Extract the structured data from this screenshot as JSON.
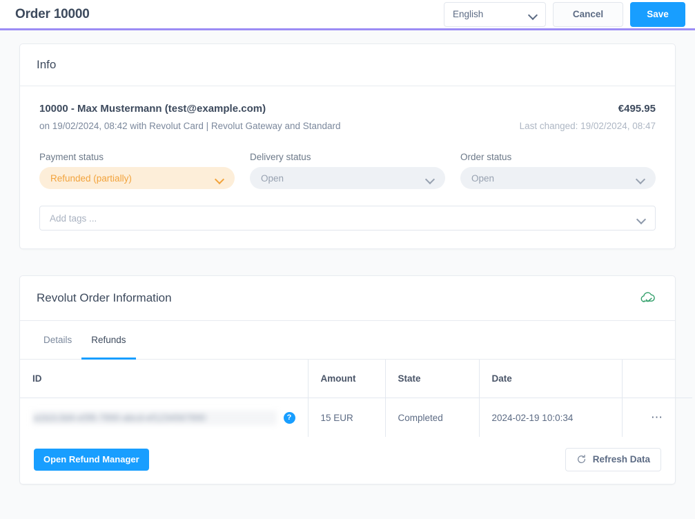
{
  "header": {
    "title": "Order 10000",
    "language": "English",
    "cancel_label": "Cancel",
    "save_label": "Save",
    "accent_line_color": "#9c8cf5",
    "primary_color": "#189eff"
  },
  "info": {
    "panel_title": "Info",
    "order_title": "10000 - Max Mustermann (test@example.com)",
    "order_subtitle": "on 19/02/2024, 08:42 with Revolut Card | Revolut Gateway and Standard",
    "amount": "€495.95",
    "last_changed": "Last changed: 19/02/2024, 08:47",
    "statuses": [
      {
        "label": "Payment status",
        "value": "Refunded (partially)",
        "style": "warning",
        "bg_color": "#fdeed9",
        "text_color": "#f2a33c"
      },
      {
        "label": "Delivery status",
        "value": "Open",
        "style": "neutral",
        "bg_color": "#eef1f5",
        "text_color": "#97a1b0"
      },
      {
        "label": "Order status",
        "value": "Open",
        "style": "neutral",
        "bg_color": "#eef1f5",
        "text_color": "#97a1b0"
      }
    ],
    "tags_placeholder": "Add tags ..."
  },
  "revolut": {
    "panel_title": "Revolut Order Information",
    "status_icon": "cloud-check-icon",
    "status_icon_color": "#2f9e68",
    "tabs": [
      {
        "label": "Details",
        "active": false
      },
      {
        "label": "Refunds",
        "active": true
      }
    ],
    "table": {
      "columns": [
        "ID",
        "Amount",
        "State",
        "Date",
        ""
      ],
      "rows": [
        {
          "id": "a1b2c3d4-e5f6-7890-abcd-ef1234567890",
          "id_redacted": true,
          "amount": "15 EUR",
          "state": "Completed",
          "date": "2024-02-19 10:0:34",
          "help_icon": "help-circle-icon",
          "actions_icon": "ellipsis-icon"
        }
      ]
    },
    "open_refund_manager_label": "Open Refund Manager",
    "refresh_label": "Refresh Data",
    "refresh_icon": "refresh-icon"
  }
}
